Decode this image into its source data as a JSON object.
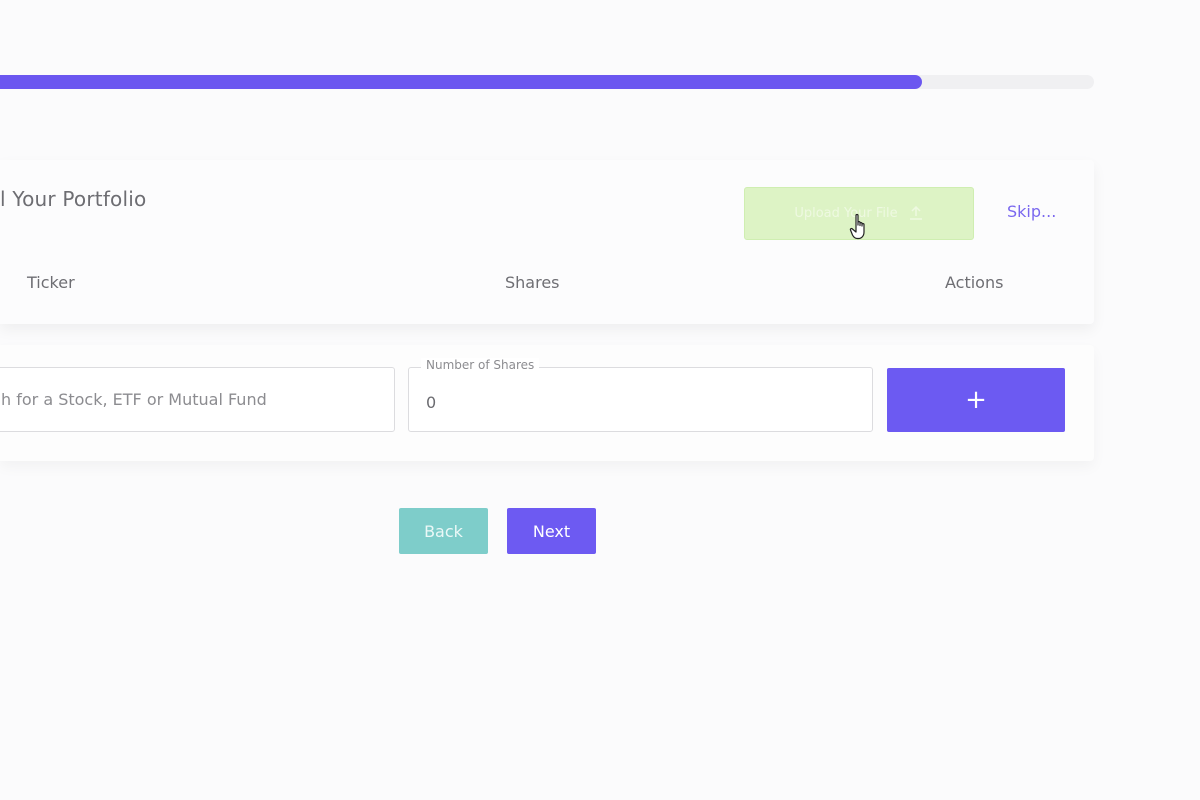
{
  "progress": {
    "fraction": 0.843
  },
  "portfolio": {
    "title": "l Your Portfolio",
    "upload_label": "Upload Your File",
    "skip_label": "Skip...",
    "columns": {
      "ticker": "Ticker",
      "shares": "Shares",
      "actions": "Actions"
    }
  },
  "entry": {
    "search_placeholder": "h for a Stock, ETF or Mutual Fund",
    "shares_label": "Number of Shares",
    "shares_value": "0",
    "add_label": "+"
  },
  "nav": {
    "back_label": "Back",
    "next_label": "Next"
  },
  "colors": {
    "accent": "#6c5af2",
    "upload_bg": "#ddf3c5",
    "back_bg": "#7ecdca"
  },
  "icons": {
    "upload": "upload-icon",
    "cursor": "hand-pointer-cursor-icon",
    "add": "plus-icon"
  }
}
